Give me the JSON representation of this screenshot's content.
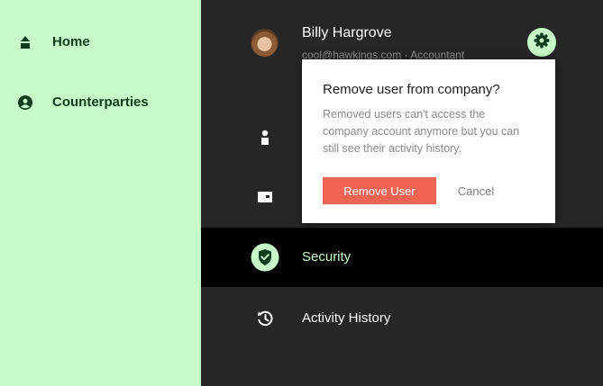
{
  "sidebar": {
    "items": [
      {
        "label": "Home",
        "icon": "home-icon"
      },
      {
        "label": "Counterparties",
        "icon": "user-circle-icon"
      }
    ]
  },
  "user": {
    "name": "Billy Hargrove",
    "subtitle": "cool@hawkings.com · Accountant"
  },
  "menu": {
    "items": [
      {
        "label": "",
        "icon": "person-icon"
      },
      {
        "label": "",
        "icon": "wallet-icon"
      },
      {
        "label": "Security",
        "icon": "shield-check-icon",
        "active": true
      },
      {
        "label": "Activity History",
        "icon": "history-icon"
      }
    ]
  },
  "dialog": {
    "title": "Remove user from company?",
    "body": "Removed users can't access the company account anymore but you can still see their activity history.",
    "confirm_label": "Remove User",
    "cancel_label": "Cancel"
  },
  "colors": {
    "accent": "#c8fcc8",
    "danger": "#ef6452",
    "background": "#262626"
  }
}
